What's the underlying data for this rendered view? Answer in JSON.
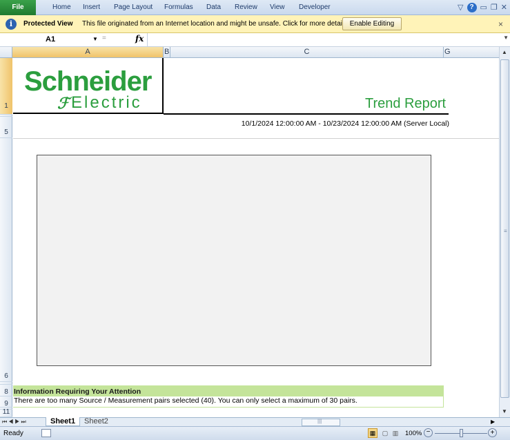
{
  "ribbon": {
    "tabs": [
      "File",
      "Home",
      "Insert",
      "Page Layout",
      "Formulas",
      "Data",
      "Review",
      "View",
      "Developer"
    ]
  },
  "protected_view": {
    "title": "Protected View",
    "message": "This file originated from an Internet location and might be unsafe. Click for more details.",
    "button": "Enable Editing",
    "close": "×"
  },
  "formula_bar": {
    "name_box": "A1",
    "fx": "fx",
    "value": ""
  },
  "columns": [
    "A",
    "B",
    "C",
    "G"
  ],
  "rows": [
    "1",
    "5",
    "6",
    "8",
    "9",
    "11"
  ],
  "report": {
    "logo_word": "Schneider",
    "logo_sub": "Electric",
    "title": "Trend Report",
    "date_range": "10/1/2024 12:00:00 AM - 10/23/2024 12:00:00 AM (Server Local)",
    "info_header": "Information Requiring Your Attention",
    "info_message": "There are too many Source / Measurement pairs selected (40).  You can only select a maximum of 30 pairs."
  },
  "sheets": {
    "tabs": [
      "Sheet1",
      "Sheet2"
    ],
    "active": "Sheet1"
  },
  "status_bar": {
    "ready": "Ready",
    "zoom": "100%"
  },
  "colors": {
    "brand_green": "#2b9e3e",
    "info_green": "#c4e49a",
    "protected_bar": "#fff3b8",
    "file_tab": "#1f7a2f"
  }
}
